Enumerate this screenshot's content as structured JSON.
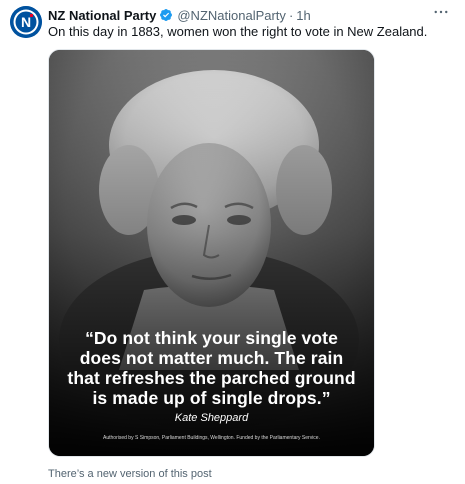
{
  "post": {
    "author_name": "NZ National Party",
    "handle": "@NZNationalParty",
    "separator": "·",
    "time": "1h",
    "text": "On this day in 1883, women won the right to vote in New Zealand.",
    "avatar_icon": "nz-national-logo",
    "verified_icon": "verified-badge-icon",
    "more_icon": "more-options-icon",
    "notice": "There’s a new version of this post"
  },
  "media": {
    "quote": "“Do not think your single vote does not matter much. The rain that refreshes the parched ground is made up of single drops.”",
    "attribution": "Kate Sheppard",
    "authorisation": "Authorised by S Simpson, Parliament Buildings, Wellington. Funded by the Parliamentary Service."
  },
  "colors": {
    "brand_blue": "#00529f",
    "verified_blue": "#1d9bf0",
    "muted_text": "#536471",
    "primary_text": "#0f1419"
  }
}
